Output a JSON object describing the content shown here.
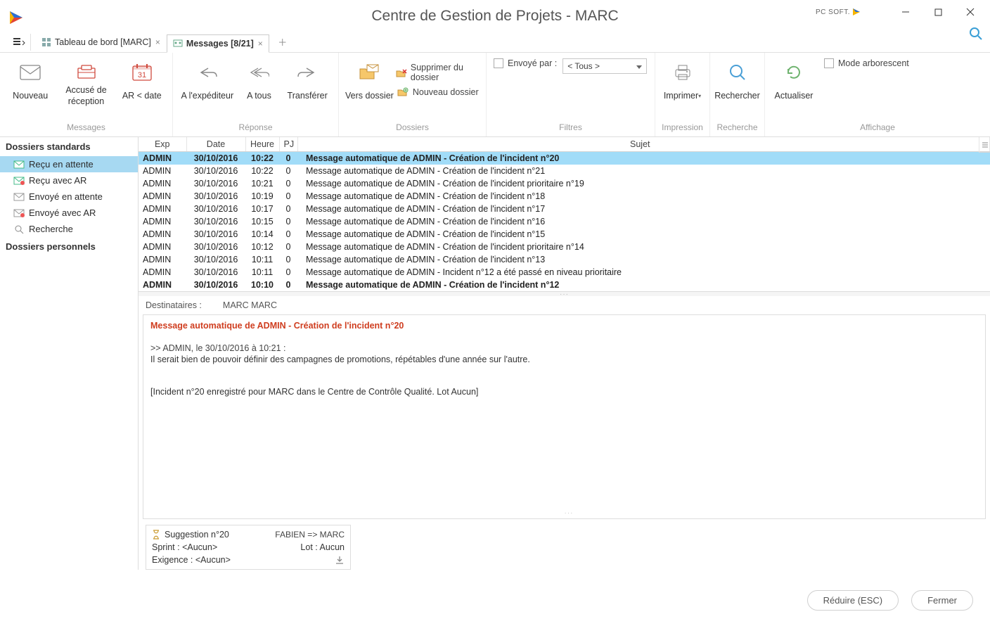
{
  "titlebar": {
    "title": "Centre de Gestion de Projets - MARC",
    "branding": "PC SOFT."
  },
  "tabs": {
    "dashboard": "Tableau de bord [MARC]",
    "messages": "Messages [8/21]"
  },
  "ribbon": {
    "group_messages": "Messages",
    "group_response": "Réponse",
    "group_dossiers": "Dossiers",
    "group_filtres": "Filtres",
    "group_impression": "Impression",
    "group_recherche": "Recherche",
    "group_affichage": "Affichage",
    "nouveau": "Nouveau",
    "accuse": "Accusé de réception",
    "ardate": "AR < date",
    "expediteur": "A  l'expéditeur",
    "atous": "A tous",
    "transferer": "Transférer",
    "vers_dossier": "Vers dossier",
    "supprimer": "Supprimer du dossier",
    "nouveau_dossier": "Nouveau dossier",
    "envoye_par": "Envoyé par :",
    "filter_value": "< Tous >",
    "imprimer": "Imprimer",
    "rechercher": "Rechercher",
    "actualiser": "Actualiser",
    "mode_arbo": "Mode arborescent"
  },
  "sidebar": {
    "standard_head": "Dossiers standards",
    "personal_head": "Dossiers personnels",
    "items": [
      {
        "label": "Reçu en attente"
      },
      {
        "label": "Reçu avec AR"
      },
      {
        "label": "Envoyé en attente"
      },
      {
        "label": "Envoyé avec AR"
      },
      {
        "label": "Recherche"
      }
    ]
  },
  "table": {
    "headers": {
      "exp": "Exp",
      "date": "Date",
      "heure": "Heure",
      "pj": "PJ",
      "sujet": "Sujet"
    },
    "rows": [
      {
        "exp": "ADMIN",
        "date": "30/10/2016",
        "heure": "10:22",
        "pj": "0",
        "sujet": "Message automatique de ADMIN - Création de l'incident n°20",
        "selected": true,
        "bold": true
      },
      {
        "exp": "ADMIN",
        "date": "30/10/2016",
        "heure": "10:22",
        "pj": "0",
        "sujet": "Message automatique de ADMIN - Création de l'incident n°21"
      },
      {
        "exp": "ADMIN",
        "date": "30/10/2016",
        "heure": "10:21",
        "pj": "0",
        "sujet": "Message automatique de ADMIN - Création de l'incident prioritaire n°19"
      },
      {
        "exp": "ADMIN",
        "date": "30/10/2016",
        "heure": "10:19",
        "pj": "0",
        "sujet": "Message automatique de ADMIN - Création de l'incident n°18"
      },
      {
        "exp": "ADMIN",
        "date": "30/10/2016",
        "heure": "10:17",
        "pj": "0",
        "sujet": "Message automatique de ADMIN - Création de l'incident n°17"
      },
      {
        "exp": "ADMIN",
        "date": "30/10/2016",
        "heure": "10:15",
        "pj": "0",
        "sujet": "Message automatique de ADMIN - Création de l'incident n°16"
      },
      {
        "exp": "ADMIN",
        "date": "30/10/2016",
        "heure": "10:14",
        "pj": "0",
        "sujet": "Message automatique de ADMIN - Création de l'incident n°15"
      },
      {
        "exp": "ADMIN",
        "date": "30/10/2016",
        "heure": "10:12",
        "pj": "0",
        "sujet": "Message automatique de ADMIN - Création de l'incident prioritaire n°14"
      },
      {
        "exp": "ADMIN",
        "date": "30/10/2016",
        "heure": "10:11",
        "pj": "0",
        "sujet": "Message automatique de ADMIN - Création de l'incident n°13"
      },
      {
        "exp": "ADMIN",
        "date": "30/10/2016",
        "heure": "10:11",
        "pj": "0",
        "sujet": "Message automatique de ADMIN - Incident n°12 a été passé en niveau prioritaire"
      },
      {
        "exp": "ADMIN",
        "date": "30/10/2016",
        "heure": "10:10",
        "pj": "0",
        "sujet": "Message automatique de ADMIN - Création de l'incident n°12",
        "bold": true
      }
    ]
  },
  "destinataires": {
    "label": "Destinataires :",
    "value": "MARC MARC"
  },
  "message": {
    "subject": "Message automatique de ADMIN - Création de l'incident n°20",
    "quote_header": ">> ADMIN, le 30/10/2016 à 10:21 :",
    "quote_body": "Il serait bien de pouvoir définir des campagnes de promotions, répétables d'une année sur l'autre.",
    "footer_note": "[Incident n°20 enregistré pour MARC dans le Centre de Contrôle Qualité. Lot Aucun]"
  },
  "card": {
    "title": "Suggestion n°20",
    "route": "FABIEN  =>  MARC",
    "sprint_label": "Sprint :",
    "sprint_value": "<Aucun>",
    "lot_label": "Lot :",
    "lot_value": "Aucun",
    "exigence_label": "Exigence :",
    "exigence_value": "<Aucun>"
  },
  "bottom": {
    "reduce": "Réduire (ESC)",
    "close": "Fermer"
  }
}
